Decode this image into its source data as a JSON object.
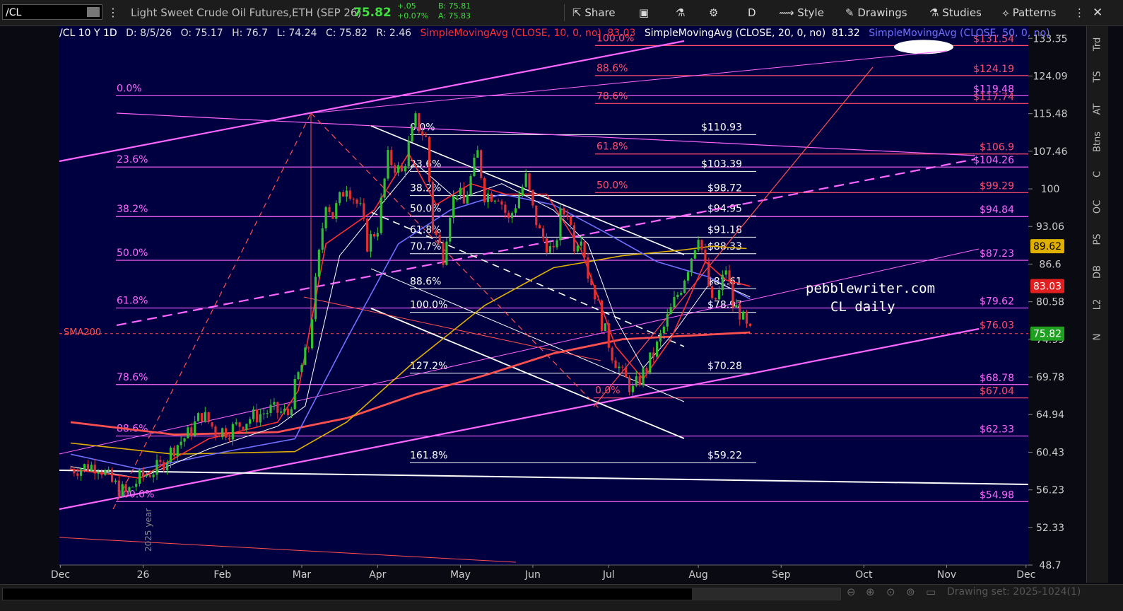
{
  "toolbar": {
    "symbol": "/CL",
    "description": "Light Sweet Crude Oil Futures,ETH (SEP 26)",
    "last": "75.82",
    "change": "+.05",
    "change_pct": "+0.07%",
    "bid": "B: 75.81",
    "ask": "A: 75.83",
    "share": "Share",
    "period": "D",
    "style": "Style",
    "drawings": "Drawings",
    "studies": "Studies",
    "patterns": "Patterns"
  },
  "infobar": {
    "title": "/CL 10 Y 1D",
    "date": "D: 8/5/26",
    "open": "O: 75.17",
    "high": "H: 76.7",
    "low": "L: 74.24",
    "close": "C: 75.82",
    "range": "R: 2.46",
    "sma10_label": "SimpleMovingAvg (CLOSE, 10, 0, no)",
    "sma10_value": "83.03",
    "sma20_label": "SimpleMovingAvg (CLOSE, 20, 0, no)",
    "sma20_value": "81.32",
    "sma50_label": "SimpleMovingAvg (CLOSE, 50, 0, no)",
    "more": "..."
  },
  "right_toolbar": [
    "Trd",
    "TS",
    "AT",
    "Btns",
    "C",
    "OC",
    "PS",
    "DB",
    "L2",
    "N"
  ],
  "bottom": {
    "drawing_set": "Drawing set: 2025-1024(1)"
  },
  "colors": {
    "background": "#000040",
    "magenta": "#ff66ff",
    "red_fib": "#ff4d6d",
    "white": "#ffffff",
    "sma10": "#ff3030",
    "sma20": "#ffffff",
    "sma50": "#7070ff",
    "sma100": "#e0b000",
    "sma200": "#ff5050",
    "up": "#30c030",
    "down": "#e03030"
  },
  "chart_data": {
    "type": "candlestick",
    "ylim": [
      48.7,
      136.5
    ],
    "y_ticks": [
      48.7,
      52.33,
      56.23,
      60.43,
      64.94,
      69.78,
      74.99,
      80.58,
      86.6,
      93.06,
      100,
      107.46,
      115.48,
      124.09,
      133.35
    ],
    "y_tick_labels": [
      "48.7",
      "52.33",
      "56.23",
      "60.43",
      "64.94",
      "69.78",
      "74.99",
      "80.58",
      "86.6",
      "93.06",
      "100",
      "107.46",
      "115.48",
      "124.09",
      "133.35"
    ],
    "x_ticks": [
      {
        "label": "Dec",
        "i": -3
      },
      {
        "label": "26",
        "i": 21
      },
      {
        "label": "Feb",
        "i": 44
      },
      {
        "label": "Mar",
        "i": 67
      },
      {
        "label": "Apr",
        "i": 89
      },
      {
        "label": "May",
        "i": 113
      },
      {
        "label": "Jun",
        "i": 134
      },
      {
        "label": "Jul",
        "i": 156
      },
      {
        "label": "Aug",
        "i": 182
      },
      {
        "label": "Sep",
        "i": 206
      },
      {
        "label": "Oct",
        "i": 230
      },
      {
        "label": "Nov",
        "i": 254
      },
      {
        "label": "Dec",
        "i": 277
      }
    ],
    "candle_path": [
      [
        0,
        58.5
      ],
      [
        8,
        59.0
      ],
      [
        12,
        57.0
      ],
      [
        16,
        55.8
      ],
      [
        20,
        57.5
      ],
      [
        26,
        58.8
      ],
      [
        30,
        61.0
      ],
      [
        34,
        62.5
      ],
      [
        38,
        65.0
      ],
      [
        42,
        63.0
      ],
      [
        46,
        63.0
      ],
      [
        52,
        64.5
      ],
      [
        58,
        65.5
      ],
      [
        63,
        65.0
      ],
      [
        66,
        70.0
      ],
      [
        69,
        74.0
      ],
      [
        72,
        88.0
      ],
      [
        74,
        98.0
      ],
      [
        76,
        95.0
      ],
      [
        80,
        101.0
      ],
      [
        84,
        96.0
      ],
      [
        86,
        90.0
      ],
      [
        89,
        93.0
      ],
      [
        92,
        106.0
      ],
      [
        96,
        103.0
      ],
      [
        100,
        114.0
      ],
      [
        103,
        110.0
      ],
      [
        105,
        93.0
      ],
      [
        108,
        88.0
      ],
      [
        110,
        96.0
      ],
      [
        112,
        100.0
      ],
      [
        114,
        97.0
      ],
      [
        118,
        107.0
      ],
      [
        120,
        99.0
      ],
      [
        124,
        99.0
      ],
      [
        127,
        94.0
      ],
      [
        132,
        102.0
      ],
      [
        134,
        96.0
      ],
      [
        136,
        92.0
      ],
      [
        140,
        88.0
      ],
      [
        142,
        95.0
      ],
      [
        144,
        96.0
      ],
      [
        146,
        90.0
      ],
      [
        148,
        92.0
      ],
      [
        150,
        85.0
      ],
      [
        152,
        82.0
      ],
      [
        154,
        77.5
      ],
      [
        157,
        73.0
      ],
      [
        160,
        70.0
      ],
      [
        163,
        68.0
      ],
      [
        167,
        71.0
      ],
      [
        170,
        74.0
      ],
      [
        173,
        78.0
      ],
      [
        177,
        83.0
      ],
      [
        180,
        88.0
      ],
      [
        182,
        92.0
      ],
      [
        184,
        86.0
      ],
      [
        186,
        80.0
      ],
      [
        188,
        82.0
      ],
      [
        190,
        86.0
      ],
      [
        192,
        80.0
      ],
      [
        194,
        79.0
      ],
      [
        196,
        76.5
      ],
      [
        197,
        75.8
      ]
    ],
    "candles_count": 198,
    "moving_averages": [
      {
        "name": "SMA200",
        "color": "#ff5050",
        "points": [
          [
            0,
            64.0
          ],
          [
            30,
            62.5
          ],
          [
            60,
            62.8
          ],
          [
            80,
            64.5
          ],
          [
            100,
            67.5
          ],
          [
            120,
            70.0
          ],
          [
            140,
            73.0
          ],
          [
            160,
            75.0
          ],
          [
            197,
            76.0
          ]
        ]
      },
      {
        "name": "SMA100",
        "color": "#e0b000",
        "points": [
          [
            0,
            61.5
          ],
          [
            30,
            60.2
          ],
          [
            65,
            60.5
          ],
          [
            80,
            64.0
          ],
          [
            100,
            72.0
          ],
          [
            120,
            80.0
          ],
          [
            140,
            86.0
          ],
          [
            160,
            88.0
          ],
          [
            178,
            89.0
          ],
          [
            186,
            89.6
          ],
          [
            196,
            89.2
          ]
        ]
      },
      {
        "name": "SMA50",
        "color": "#7070ff",
        "points": [
          [
            0,
            60.2
          ],
          [
            20,
            58.5
          ],
          [
            45,
            60.5
          ],
          [
            65,
            62.0
          ],
          [
            80,
            75.0
          ],
          [
            95,
            90.0
          ],
          [
            110,
            96.0
          ],
          [
            125,
            99.0
          ],
          [
            140,
            97.0
          ],
          [
            155,
            92.0
          ],
          [
            170,
            87.0
          ],
          [
            185,
            84.5
          ],
          [
            197,
            81.0
          ]
        ]
      },
      {
        "name": "SMA20",
        "color": "#ffffff",
        "points": [
          [
            0,
            58.8
          ],
          [
            20,
            57.5
          ],
          [
            40,
            60.8
          ],
          [
            60,
            63.5
          ],
          [
            68,
            66.0
          ],
          [
            78,
            88.0
          ],
          [
            90,
            97.0
          ],
          [
            100,
            105.0
          ],
          [
            112,
            98.0
          ],
          [
            125,
            101.0
          ],
          [
            140,
            96.0
          ],
          [
            150,
            90.0
          ],
          [
            158,
            78.0
          ],
          [
            166,
            71.0
          ],
          [
            175,
            76.0
          ],
          [
            186,
            84.0
          ],
          [
            197,
            81.3
          ]
        ]
      },
      {
        "name": "SMA10",
        "color": "#ff3030",
        "points": [
          [
            0,
            58.5
          ],
          [
            20,
            57.5
          ],
          [
            40,
            62.0
          ],
          [
            60,
            64.0
          ],
          [
            66,
            68.0
          ],
          [
            74,
            90.0
          ],
          [
            88,
            96.0
          ],
          [
            98,
            107.0
          ],
          [
            106,
            97.0
          ],
          [
            116,
            101.0
          ],
          [
            126,
            99.0
          ],
          [
            138,
            99.0
          ],
          [
            148,
            89.0
          ],
          [
            158,
            74.0
          ],
          [
            166,
            69.5
          ],
          [
            174,
            75.0
          ],
          [
            184,
            87.0
          ],
          [
            190,
            84.0
          ],
          [
            197,
            83.0
          ]
        ]
      }
    ],
    "fib_left": {
      "color": "#ff66ff",
      "levels": [
        {
          "label": "0.0%",
          "price": 119.48
        },
        {
          "label": "23.6%",
          "price": 104.26
        },
        {
          "label": "38.2%",
          "price": 94.84
        },
        {
          "label": "50.0%",
          "price": 87.23
        },
        {
          "label": "61.8%",
          "price": 79.62
        },
        {
          "label": "78.6%",
          "price": 68.78
        },
        {
          "label": "88.6%",
          "price": 62.33
        },
        {
          "label": "100.0%",
          "price": 54.98
        }
      ]
    },
    "fib_mid": {
      "color": "#ffffff",
      "levels": [
        {
          "label": "0.0%",
          "price": 110.93
        },
        {
          "label": "23.6%",
          "price": 103.39
        },
        {
          "label": "38.2%",
          "price": 98.72
        },
        {
          "label": "50.0%",
          "price": 94.95
        },
        {
          "label": "61.8%",
          "price": 91.18
        },
        {
          "label": "70.7%",
          "price": 88.33
        },
        {
          "label": "88.6%",
          "price": 82.61
        },
        {
          "label": "100.0%",
          "price": 78.97
        },
        {
          "label": "127.2%",
          "price": 70.28
        },
        {
          "label": "161.8%",
          "price": 59.22
        }
      ],
      "price_labels": [
        "$110.93",
        "$103.39",
        "$98.72",
        "$94.95",
        "$91.18",
        "$88.33",
        "$82.61",
        "$78.97",
        "$70.28",
        "$59.22"
      ]
    },
    "fib_red": {
      "color": "#ff4d6d",
      "levels": [
        {
          "label": "100.0%",
          "price": 131.54
        },
        {
          "label": "88.6%",
          "price": 124.19
        },
        {
          "label": "78.6%",
          "price": 117.74
        },
        {
          "label": "61.8%",
          "price": 106.9
        },
        {
          "label": "50.0%",
          "price": 99.29
        },
        {
          "label": "0.0%",
          "price": 67.04
        }
      ]
    },
    "right_price_labels": [
      {
        "text": "$131.54",
        "price": 131.54,
        "color": "#ff4d6d"
      },
      {
        "text": "$124.19",
        "price": 124.19,
        "color": "#ff4d6d"
      },
      {
        "text": "$119.48",
        "price": 119.48,
        "color": "#ff66ff"
      },
      {
        "text": "$117.74",
        "price": 117.74,
        "color": "#ff4d6d"
      },
      {
        "text": "$106.9",
        "price": 106.9,
        "color": "#ff4d6d"
      },
      {
        "text": "$104.26",
        "price": 104.26,
        "color": "#ff66ff"
      },
      {
        "text": "$99.29",
        "price": 99.29,
        "color": "#ff4d6d"
      },
      {
        "text": "$94.84",
        "price": 94.84,
        "color": "#ff66ff"
      },
      {
        "text": "$87.23",
        "price": 87.23,
        "color": "#ff66ff"
      },
      {
        "text": "$79.62",
        "price": 79.62,
        "color": "#ff66ff"
      },
      {
        "text": "$76.03",
        "price": 76.03,
        "color": "#ff4d6d"
      },
      {
        "text": "$68.78",
        "price": 68.78,
        "color": "#ff66ff"
      },
      {
        "text": "$67.04",
        "price": 67.04,
        "color": "#ff4d6d"
      },
      {
        "text": "$62.33",
        "price": 62.33,
        "color": "#ff66ff"
      },
      {
        "text": "$54.98",
        "price": 54.98,
        "color": "#ff66ff"
      }
    ],
    "axis_badges": [
      {
        "text": "89.62",
        "price": 89.62,
        "color": "#e0b000",
        "fg": "#000"
      },
      {
        "text": "83.03",
        "price": 83.03,
        "color": "#e02020",
        "fg": "#fff"
      },
      {
        "text": "75.82",
        "price": 75.82,
        "color": "#20a020",
        "fg": "#fff"
      }
    ],
    "annotations": {
      "sma200": "SMA200",
      "watermark_line1": "pebblewriter.com",
      "watermark_line2": "CL daily",
      "year_marker": "2025 year"
    }
  }
}
